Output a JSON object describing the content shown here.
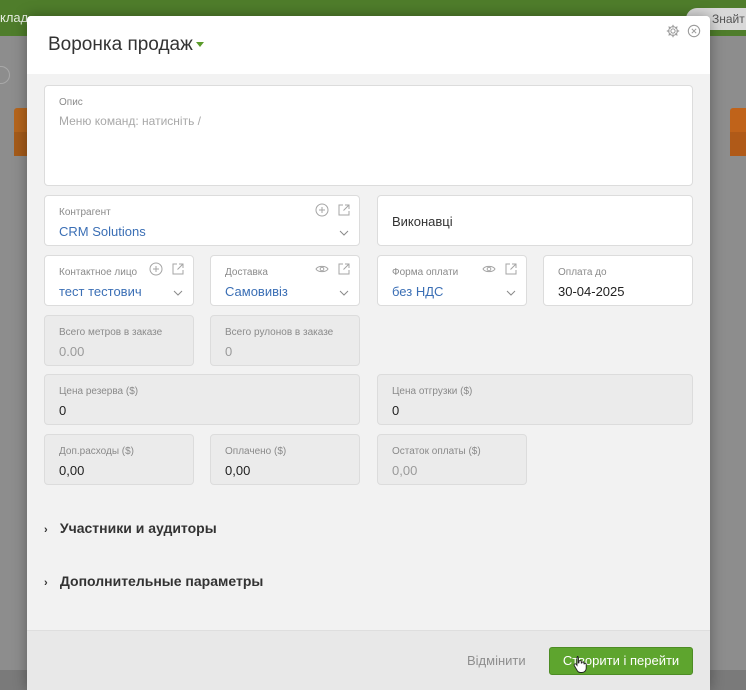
{
  "background": {
    "topbar_text": "клад",
    "search_text": "Знайт"
  },
  "modal": {
    "title": "Воронка продаж",
    "fields": {
      "description": {
        "label": "Опис",
        "placeholder": "Меню команд: натисніть /"
      },
      "counterparty": {
        "label": "Контрагент",
        "value": "CRM Solutions"
      },
      "executors": {
        "label": "Виконавці"
      },
      "contact": {
        "label": "Контактное лицо",
        "value": "тест тестович"
      },
      "delivery": {
        "label": "Доставка",
        "value": "Самовивіз"
      },
      "payment_form": {
        "label": "Форма оплати",
        "value": "без НДС"
      },
      "pay_until": {
        "label": "Оплата до",
        "value": "30-04-2025"
      },
      "total_meters": {
        "label": "Всего метров в заказе",
        "value": "0.00"
      },
      "total_rolls": {
        "label": "Всего рулонов в заказе",
        "value": "0"
      },
      "reserve_price": {
        "label": "Цена резерва ($)",
        "value": "0"
      },
      "shipment_price": {
        "label": "Цена отгрузки ($)",
        "value": "0"
      },
      "extra_costs": {
        "label": "Доп.расходы ($)",
        "value": "0,00"
      },
      "paid": {
        "label": "Оплачено ($)",
        "value": "0,00"
      },
      "balance": {
        "label": "Остаток оплаты ($)",
        "value": "0,00"
      }
    },
    "sections": {
      "participants": "Участники и аудиторы",
      "extra_params": "Дополнительные параметры"
    },
    "footer": {
      "cancel_label": "Відмінити",
      "submit_label": "Створити і перейти"
    }
  },
  "colors": {
    "accent": "#5ea52e",
    "link": "#3b6fb5",
    "topbar": "#4f7d2b"
  }
}
